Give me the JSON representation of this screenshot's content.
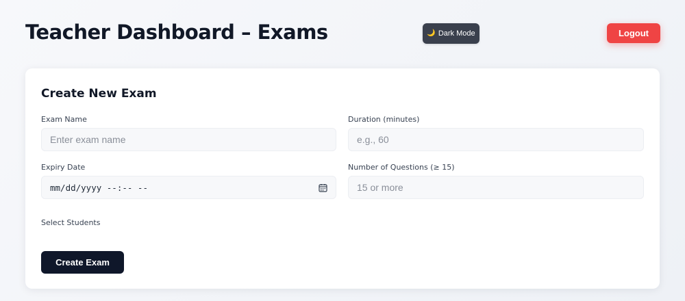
{
  "header": {
    "title": "Teacher Dashboard – Exams",
    "dark_mode_label": "Dark Mode",
    "dark_mode_icon": "🌙",
    "logout_label": "Logout"
  },
  "form": {
    "title": "Create New Exam",
    "exam_name": {
      "label": "Exam Name",
      "placeholder": "Enter exam name",
      "value": ""
    },
    "duration": {
      "label": "Duration (minutes)",
      "placeholder": "e.g., 60",
      "value": ""
    },
    "expiry": {
      "label": "Expiry Date",
      "display": "mm/dd/yyyy --:-- --",
      "icon": "calendar-icon"
    },
    "num_questions": {
      "label": "Number of Questions (≥ 15)",
      "placeholder": "15 or more",
      "value": ""
    },
    "students": {
      "label": "Select Students"
    },
    "submit_label": "Create Exam"
  },
  "colors": {
    "logout": "#ef4444",
    "dark_toggle": "#3a404d",
    "primary_button": "#0f172a"
  }
}
